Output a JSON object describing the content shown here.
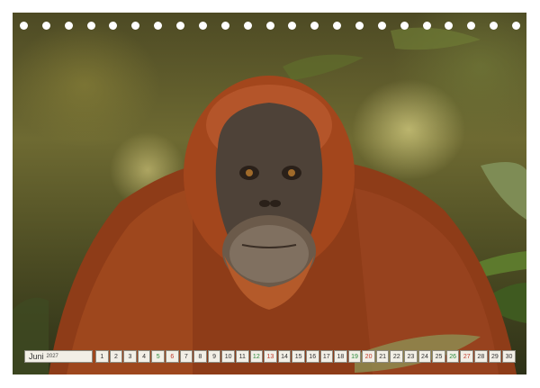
{
  "calendar": {
    "month": "Juni",
    "year": "2027",
    "days": [
      {
        "n": "1",
        "type": "weekday"
      },
      {
        "n": "2",
        "type": "weekday"
      },
      {
        "n": "3",
        "type": "weekday"
      },
      {
        "n": "4",
        "type": "weekday"
      },
      {
        "n": "5",
        "type": "sat"
      },
      {
        "n": "6",
        "type": "sun"
      },
      {
        "n": "7",
        "type": "weekday"
      },
      {
        "n": "8",
        "type": "weekday"
      },
      {
        "n": "9",
        "type": "weekday"
      },
      {
        "n": "10",
        "type": "weekday"
      },
      {
        "n": "11",
        "type": "weekday"
      },
      {
        "n": "12",
        "type": "sat"
      },
      {
        "n": "13",
        "type": "sun"
      },
      {
        "n": "14",
        "type": "weekday"
      },
      {
        "n": "15",
        "type": "weekday"
      },
      {
        "n": "16",
        "type": "weekday"
      },
      {
        "n": "17",
        "type": "weekday"
      },
      {
        "n": "18",
        "type": "weekday"
      },
      {
        "n": "19",
        "type": "sat"
      },
      {
        "n": "20",
        "type": "sun"
      },
      {
        "n": "21",
        "type": "weekday"
      },
      {
        "n": "22",
        "type": "weekday"
      },
      {
        "n": "23",
        "type": "weekday"
      },
      {
        "n": "24",
        "type": "weekday"
      },
      {
        "n": "25",
        "type": "weekday"
      },
      {
        "n": "26",
        "type": "sat"
      },
      {
        "n": "27",
        "type": "sun"
      },
      {
        "n": "28",
        "type": "weekday"
      },
      {
        "n": "29",
        "type": "weekday"
      },
      {
        "n": "30",
        "type": "weekday"
      }
    ]
  },
  "binding": {
    "hole_count": 23
  },
  "colors": {
    "saturday": "#2a8a3a",
    "sunday": "#c0392b",
    "fur": "#a3461c",
    "background": "#4d4a24"
  }
}
